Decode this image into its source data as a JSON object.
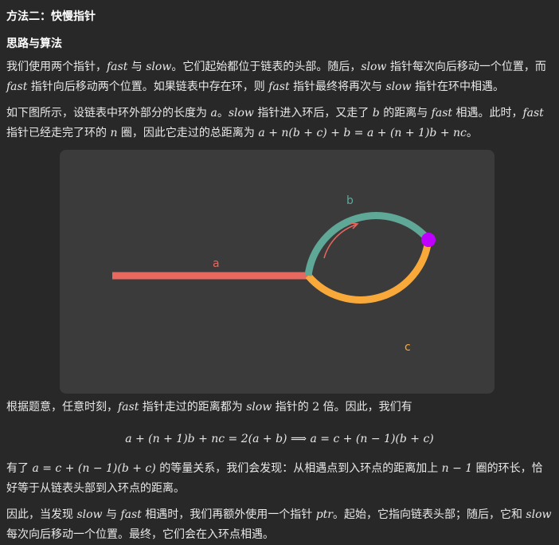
{
  "heading1": "方法二：快慢指针",
  "heading2": "思路与算法",
  "para1": {
    "a": "我们使用两个指针，",
    "fast": "fast",
    "b": " 与 ",
    "slow": "slow",
    "c": "。它们起始都位于链表的头部。随后，",
    "slow2": "slow",
    "d": " 指针每次向后移动一个位置，而",
    "fast2": "fast",
    "e": " 指针向后移动两个位置。如果链表中存在环，则 ",
    "fast3": "fast",
    "f": " 指针最终将再次与 ",
    "slow3": "slow",
    "g": " 指针在环中相遇。"
  },
  "para2": {
    "a": "如下图所示，设链表中环外部分的长度为 ",
    "va": "a",
    "b": "。",
    "slow": "slow",
    "c": " 指针进入环后，又走了 ",
    "vb": "b",
    "d": " 的距离与 ",
    "fast": "fast",
    "e": " 相遇。此时，",
    "fast2": "fast",
    "f": "指针已经走完了环的 ",
    "vn": "n",
    "g": " 圈，因此它走过的总距离为 ",
    "formula": "a + n(b + c) + b = a + (n + 1)b + nc",
    "h": "。"
  },
  "figure": {
    "label_a": "a",
    "label_b": "b",
    "label_c": "c",
    "colors": {
      "a_segment": "#e8675e",
      "b_arc": "#5fa898",
      "c_arc": "#f9a93a",
      "meet_point": "#c000ff",
      "background": "#3b3b3b"
    }
  },
  "para3": {
    "a": "根据题意，任意时刻，",
    "fast": "fast",
    "b": " 指针走过的距离都为 ",
    "slow": "slow",
    "c": " 指针的 ",
    "two": "2",
    "d": " 倍。因此，我们有"
  },
  "equation": "a + (n + 1)b + nc = 2(a + b)  ⟹  a = c + (n − 1)(b + c)",
  "para4": {
    "a": "有了 ",
    "formula": "a = c + (n − 1)(b + c)",
    "b": " 的等量关系，我们会发现：从相遇点到入环点的距离加上 ",
    "n1": "n − 1",
    "c": " 圈的环长，恰好等于从链表头部到入环点的距离。"
  },
  "para5": {
    "a": "因此，当发现 ",
    "slow": "slow",
    "b": " 与 ",
    "fast": "fast",
    "c": " 相遇时，我们再额外使用一个指针 ",
    "ptr": "ptr",
    "d": "。起始，它指向链表头部；随后，它和 ",
    "slow2": "slow",
    "e": "每次向后移动一个位置。最终，它们会在入环点相遇。"
  }
}
